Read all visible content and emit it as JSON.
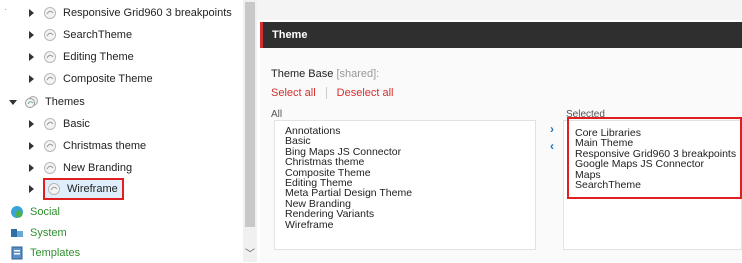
{
  "tree": {
    "items": [
      {
        "label": "Responsive Grid960 3 breakpoints",
        "expander": "collapsed",
        "icon": "theme-item-icon"
      },
      {
        "label": "SearchTheme",
        "expander": "collapsed",
        "icon": "theme-item-icon"
      },
      {
        "label": "Editing Theme",
        "expander": "collapsed",
        "icon": "theme-item-icon"
      },
      {
        "label": "Composite Theme",
        "expander": "collapsed",
        "icon": "theme-item-icon"
      },
      {
        "label": "Themes",
        "expander": "expanded",
        "icon": "themes-folder-icon"
      },
      {
        "label": "Basic",
        "expander": "collapsed",
        "icon": "theme-item-icon"
      },
      {
        "label": "Christmas theme",
        "expander": "collapsed",
        "icon": "theme-item-icon"
      },
      {
        "label": "New Branding",
        "expander": "collapsed",
        "icon": "theme-item-icon"
      },
      {
        "label": "Wireframe",
        "expander": "collapsed",
        "icon": "theme-item-icon",
        "selected": true
      },
      {
        "label": "Social",
        "expander": "none",
        "icon": "social-icon"
      },
      {
        "label": "System",
        "expander": "none",
        "icon": "system-icon"
      },
      {
        "label": "Templates",
        "expander": "none",
        "icon": "templates-icon"
      }
    ]
  },
  "section": {
    "title": "Theme"
  },
  "field": {
    "label": "Theme Base",
    "shared": "[shared]:"
  },
  "actions": {
    "select_all": "Select all",
    "deselect_all": "Deselect all"
  },
  "all_list": {
    "label": "All",
    "items": [
      "Annotations",
      "Basic",
      "Bing Maps JS Connector",
      "Christmas theme",
      "Composite Theme",
      "Editing Theme",
      "Meta Partial Design Theme",
      "New Branding",
      "Rendering Variants",
      "Wireframe"
    ]
  },
  "selected_list": {
    "label": "Selected",
    "items": [
      "Core Libraries",
      "Main Theme",
      "Responsive Grid960 3 breakpoints",
      "Google Maps JS Connector",
      "Maps",
      "SearchTheme"
    ]
  },
  "move": {
    "right_glyph": "›",
    "left_glyph": "‹"
  },
  "colors": {
    "accent_red": "#d32f2f",
    "header_bg": "#2f2f2f",
    "highlight_border": "#e02020",
    "arrow_blue": "#1b75bc"
  }
}
